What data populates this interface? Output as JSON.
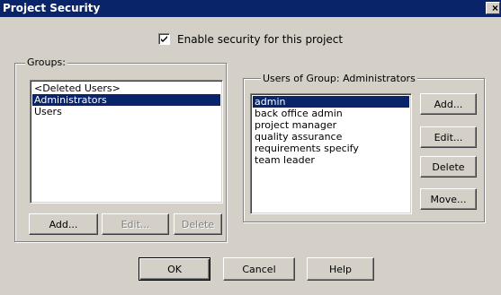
{
  "window": {
    "title": "Project Security",
    "close_glyph": "×"
  },
  "enable_security": {
    "label": "Enable security for this project",
    "checked": true
  },
  "groups": {
    "label": "Groups:",
    "items": [
      {
        "label": "<Deleted Users>",
        "selected": false
      },
      {
        "label": "Administrators",
        "selected": true
      },
      {
        "label": "Users",
        "selected": false
      }
    ],
    "add_label": "Add...",
    "edit_label": "Edit...",
    "delete_label": "Delete"
  },
  "users": {
    "label": "Users of Group: Administrators",
    "items": [
      {
        "label": "admin",
        "selected": true
      },
      {
        "label": "back office admin",
        "selected": false
      },
      {
        "label": "project manager",
        "selected": false
      },
      {
        "label": "quality assurance",
        "selected": false
      },
      {
        "label": "requirements specify",
        "selected": false
      },
      {
        "label": "team leader",
        "selected": false
      }
    ],
    "add_label": "Add...",
    "edit_label": "Edit...",
    "delete_label": "Delete",
    "move_label": "Move..."
  },
  "footer": {
    "ok_label": "OK",
    "cancel_label": "Cancel",
    "help_label": "Help"
  },
  "colors": {
    "titlebar": "#0a246a",
    "face": "#d4d0c8",
    "selection": "#0a246a"
  }
}
